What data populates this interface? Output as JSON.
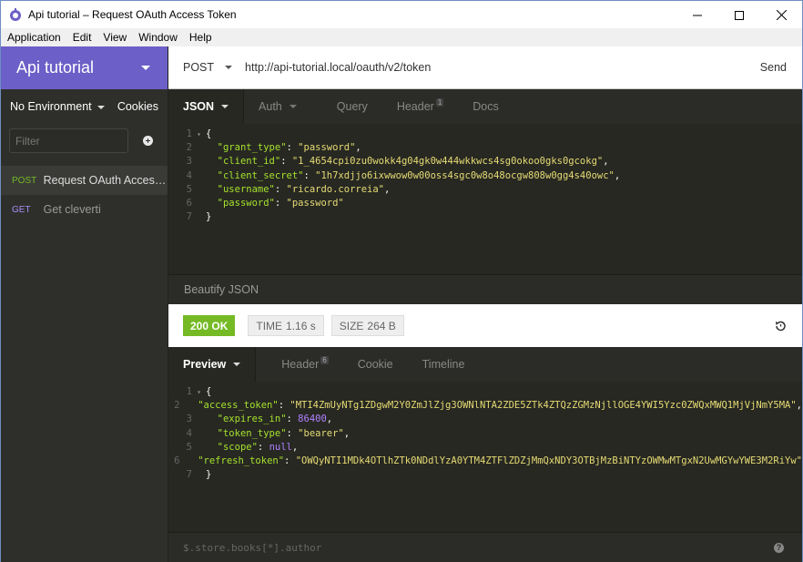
{
  "window": {
    "title": "Api tutorial – Request OAuth Access Token"
  },
  "menu": [
    "Application",
    "Edit",
    "View",
    "Window",
    "Help"
  ],
  "sidebar": {
    "workspace": "Api tutorial",
    "environment": "No Environment",
    "cookies": "Cookies",
    "filter_placeholder": "Filter",
    "requests": [
      {
        "method": "POST",
        "name": "Request OAuth Access Token",
        "display": "Request OAuth Access…",
        "active": true
      },
      {
        "method": "GET",
        "name": "Get cleverti",
        "display": "Get cleverti",
        "active": false
      }
    ]
  },
  "urlbar": {
    "method": "POST",
    "url": "http://api-tutorial.local/oauth/v2/token",
    "send": "Send"
  },
  "request": {
    "tabs": {
      "json": "JSON",
      "auth": "Auth",
      "query": "Query",
      "header": "Header",
      "header_count": "1",
      "docs": "Docs"
    },
    "body_lines": [
      "{",
      "  \"grant_type\": \"password\",",
      "  \"client_id\": \"1_4654cpi0zu0wokk4g04gk0w444wkkwcs4sg0okoo0gks0gcokg\",",
      "  \"client_secret\": \"1h7xdjjo6ixwwow0w00oss4sgc0w8o48ocgw808w0gg4s40owc\",",
      "  \"username\": \"ricardo.correia\",",
      "  \"password\": \"password\"",
      "}"
    ],
    "beautify": "Beautify JSON"
  },
  "status": {
    "code": "200 OK",
    "time_label": "TIME",
    "time": "1.16 s",
    "size_label": "SIZE",
    "size": "264 B",
    "ok_color": "#75ba24"
  },
  "response": {
    "tabs": {
      "preview": "Preview",
      "header": "Header",
      "header_count": "6",
      "cookie": "Cookie",
      "timeline": "Timeline"
    },
    "body_lines": [
      "{",
      "  \"access_token\": \"MTI4ZmUyNTg1ZDgwM2Y0ZmJlZjg3OWNlNTA2ZDE5ZTk4ZTQzZGMzNjllOGE4YWI5Yzc0ZWQxMWQ1MjVjNmY5MA\",",
      "  \"expires_in\": 86400,",
      "  \"token_type\": \"bearer\",",
      "  \"scope\": null,",
      "  \"refresh_token\": \"OWQyNTI1MDk4OTlhZTk0NDdlYzA0YTM4ZTFlZDZjMmQxNDY3OTBjMzBiNTYzOWMwMTgxN2UwMGYwYWE3M2RiYw\"",
      "}"
    ],
    "query_placeholder": "$.store.books[*].author"
  }
}
